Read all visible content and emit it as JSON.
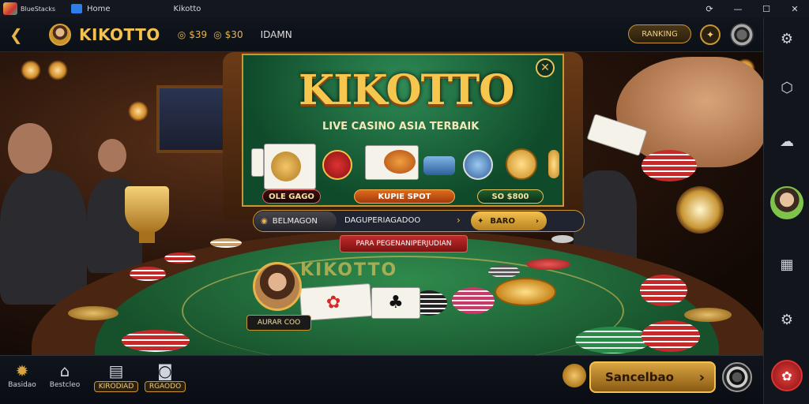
{
  "titlebar": {
    "brand": "BlueStacks",
    "tab1": "Home",
    "tab2": "Kikotto",
    "controls": [
      "⟳",
      "—",
      "☐",
      "✕"
    ]
  },
  "header": {
    "title": "KIKOTTO",
    "balance_coins": "$39",
    "balance_gems": "$30",
    "user": "IDAMN",
    "action_button": "RANKING"
  },
  "board": {
    "logo": "KIKOTTO",
    "tagline": "LIVE CASINO ASIA TERBAIK",
    "pill1": "OLE GAGO",
    "pill2": "KUPIE SPOT",
    "pill3": "SO $800"
  },
  "action_bar": {
    "left": "BELMAGON",
    "middle": "DAGUPERIAGADOO",
    "right": "BARO"
  },
  "banner": "PARA PEGENANIPERJUDIAN",
  "felt_text": "KIKOTTO",
  "dealer_tag": "AURAR COO",
  "bottom_nav": [
    {
      "label": "Basidao"
    },
    {
      "label": "Bestcleo"
    },
    {
      "label": "KIRODIAD"
    },
    {
      "label": "RGAODO"
    }
  ],
  "cta": "Sancelbao",
  "colors": {
    "accent": "#f2c14e",
    "felt": "#2f8a4d",
    "danger": "#c02a2a"
  }
}
